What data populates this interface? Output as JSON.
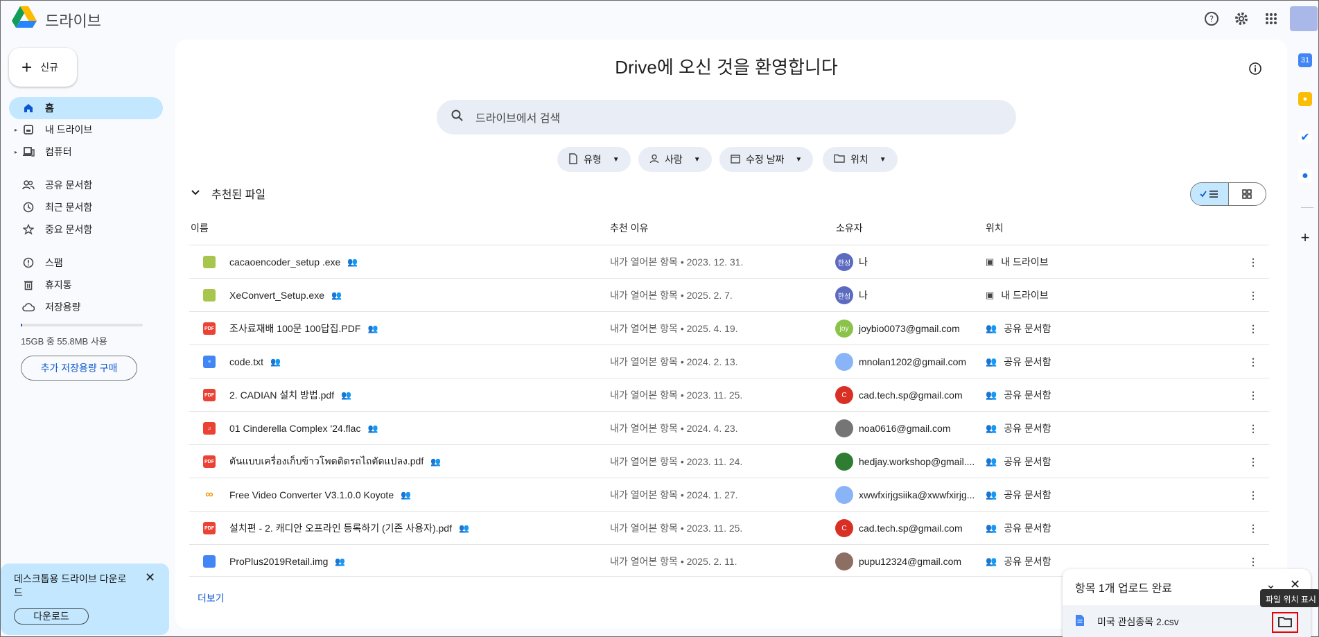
{
  "app": {
    "title": "드라이브"
  },
  "sidebar": {
    "new_label": "신규",
    "items": [
      {
        "label": "홈",
        "icon": "home-icon"
      },
      {
        "label": "내 드라이브",
        "icon": "my-drive-icon"
      },
      {
        "label": "컴퓨터",
        "icon": "computer-icon"
      },
      {
        "label": "공유 문서함",
        "icon": "shared-icon"
      },
      {
        "label": "최근 문서함",
        "icon": "clock-icon"
      },
      {
        "label": "중요 문서함",
        "icon": "star-icon"
      },
      {
        "label": "스팸",
        "icon": "spam-icon"
      },
      {
        "label": "휴지통",
        "icon": "trash-icon"
      },
      {
        "label": "저장용량",
        "icon": "cloud-icon"
      }
    ],
    "storage_text": "15GB 중 55.8MB 사용",
    "storage_fraction": 0.004,
    "buy_storage_label": "추가 저장용량 구매"
  },
  "promo": {
    "text": "데스크톱용 드라이브 다운로드",
    "download_label": "다운로드"
  },
  "main": {
    "welcome": "Drive에 오신 것을 환영합니다",
    "search_placeholder": "드라이브에서 검색",
    "filters": [
      "유형",
      "사람",
      "수정 날짜",
      "위치"
    ],
    "section_title": "추천된 파일",
    "columns": [
      "이름",
      "추천 이유",
      "소유자",
      "위치"
    ],
    "more_label": "더보기"
  },
  "files": [
    {
      "name": "cacaoencoder_setup .exe",
      "type": "exe",
      "reason": "내가 열어본 항목 • 2023. 12. 31.",
      "owner": "나",
      "owner_avatar": "한성",
      "location": "내 드라이브",
      "loc_icon": "drive"
    },
    {
      "name": "XeConvert_Setup.exe",
      "type": "exe",
      "reason": "내가 열어본 항목 • 2025. 2. 7.",
      "owner": "나",
      "owner_avatar": "한성",
      "location": "내 드라이브",
      "loc_icon": "drive"
    },
    {
      "name": "조사료재배 100문 100답집.PDF",
      "type": "pdf",
      "reason": "내가 열어본 항목 • 2025. 4. 19.",
      "owner": "joybio0073@gmail.com",
      "owner_avatar": "joy",
      "location": "공유 문서함",
      "loc_icon": "shared"
    },
    {
      "name": "code.txt",
      "type": "doc",
      "reason": "내가 열어본 항목 • 2024. 2. 13.",
      "owner": "mnolan1202@gmail.com",
      "owner_avatar": "",
      "location": "공유 문서함",
      "loc_icon": "shared"
    },
    {
      "name": "2. CADIAN 설치 방법.pdf",
      "type": "pdf",
      "reason": "내가 열어본 항목 • 2023. 11. 25.",
      "owner": "cad.tech.sp@gmail.com",
      "owner_avatar": "C",
      "location": "공유 문서함",
      "loc_icon": "shared"
    },
    {
      "name": "01 Cinderella Complex '24.flac",
      "type": "audio",
      "reason": "내가 열어본 항목 • 2024. 4. 23.",
      "owner": "noa0616@gmail.com",
      "owner_avatar": "",
      "location": "공유 문서함",
      "loc_icon": "shared"
    },
    {
      "name": "ตันแบบเครื่องเก็บข้าวโพดติดรถไถตัดแปลง.pdf",
      "type": "pdf",
      "reason": "내가 열어본 항목 • 2023. 11. 24.",
      "owner": "hedjay.workshop@gmail....",
      "owner_avatar": "",
      "location": "공유 문서함",
      "loc_icon": "shared"
    },
    {
      "name": "Free Video Converter V3.1.0.0 Koyote",
      "type": "link",
      "reason": "내가 열어본 항목 • 2024. 1. 27.",
      "owner": "xwwfxirjgsiika@xwwfxirjg...",
      "owner_avatar": "",
      "location": "공유 문서함",
      "loc_icon": "shared"
    },
    {
      "name": "설치편 - 2. 캐디안 오프라인 등록하기 (기존 사용자).pdf",
      "type": "pdf",
      "reason": "내가 열어본 항목 • 2023. 11. 25.",
      "owner": "cad.tech.sp@gmail.com",
      "owner_avatar": "C",
      "location": "공유 문서함",
      "loc_icon": "shared"
    },
    {
      "name": "ProPlus2019Retail.img",
      "type": "file",
      "reason": "내가 열어본 항목 • 2025. 2. 11.",
      "owner": "pupu12324@gmail.com",
      "owner_avatar": "",
      "location": "공유 문서함",
      "loc_icon": "shared"
    }
  ],
  "upload": {
    "title": "항목 1개 업로드 완료",
    "file": "미국 관심종목 2.csv",
    "tooltip": "파일 위치 표시"
  },
  "colors": {
    "accent": "#0b57d0",
    "active_nav": "#c2e7ff",
    "pdf": "#ea4335",
    "exe": "#a8c64e",
    "doc": "#4285f4"
  }
}
